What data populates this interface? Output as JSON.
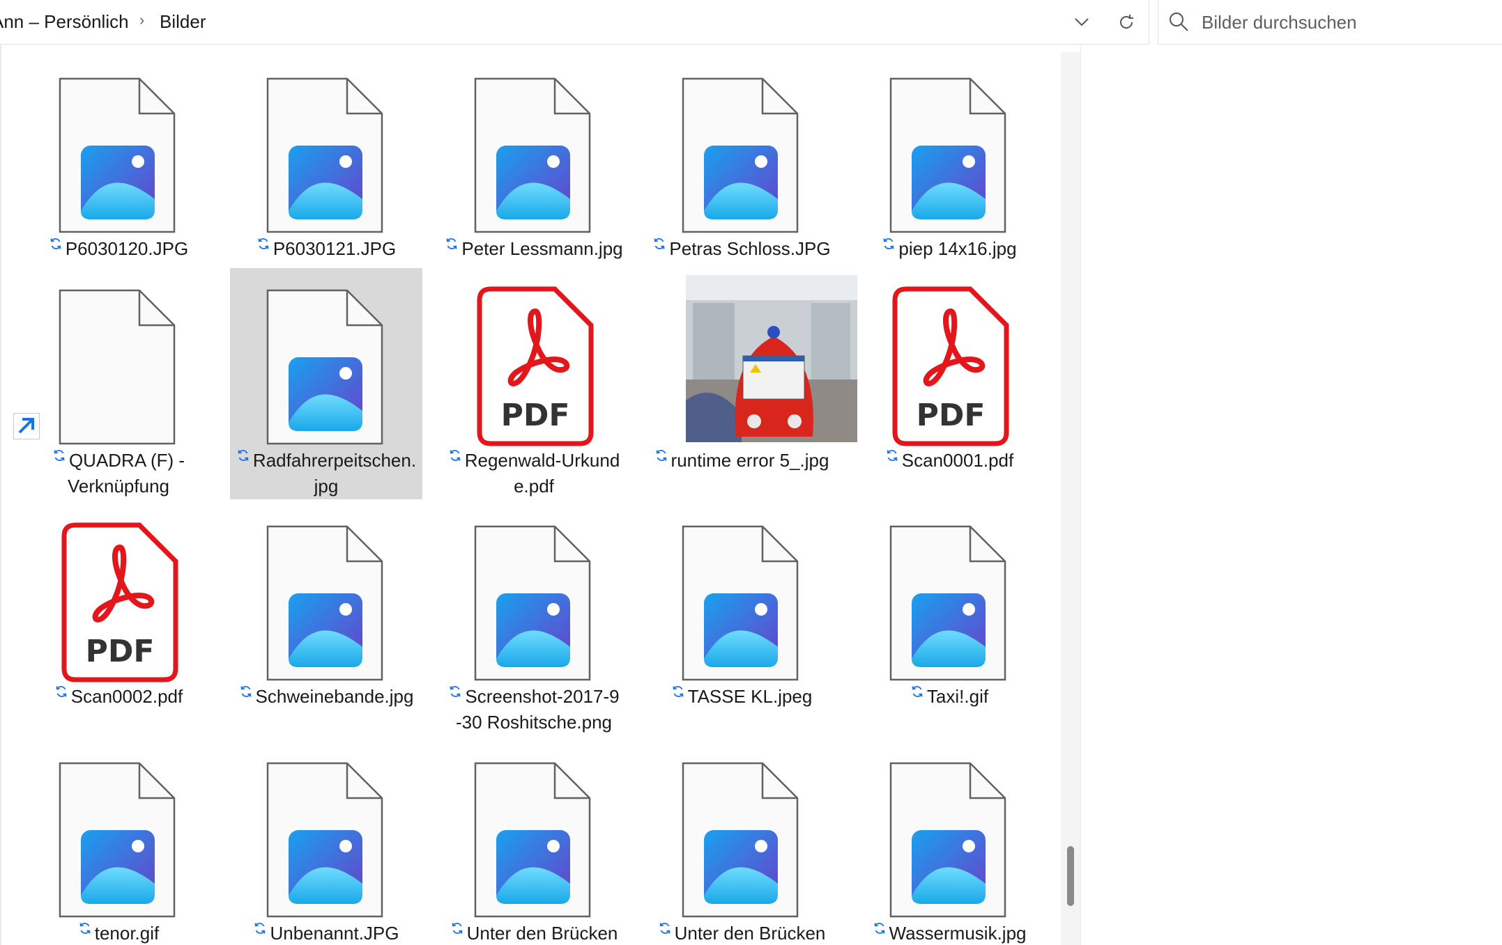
{
  "breadcrumb": {
    "parent": "Ann – Persönlich",
    "current": "Bilder"
  },
  "search": {
    "placeholder": "Bilder durchsuchen"
  },
  "icons": {
    "chevron": "chevron-down-icon",
    "refresh": "refresh-icon",
    "search": "search-icon",
    "sync": "sync-status-icon",
    "image": "image-file-icon",
    "pdf": "pdf-file-icon",
    "blank": "blank-file-icon",
    "shortcut": "shortcut-arrow-icon"
  },
  "colors": {
    "pdf_red": "#e3161b",
    "sync_blue": "#1a73e8",
    "selected_bg": "#d9d9d9"
  },
  "files": [
    {
      "name": "P6030120.JPG",
      "line1": "P6030120.JPG",
      "line2": "",
      "type": "image"
    },
    {
      "name": "P6030121.JPG",
      "line1": "P6030121.JPG",
      "line2": "",
      "type": "image"
    },
    {
      "name": "Peter Lessmann.jpg",
      "line1": "Peter Lessmann.jpg",
      "line2": "",
      "type": "image"
    },
    {
      "name": "Petras Schloss.JPG",
      "line1": "Petras Schloss.JPG",
      "line2": "",
      "type": "image"
    },
    {
      "name": "piep 14x16.jpg",
      "line1": "piep 14x16.jpg",
      "line2": "",
      "type": "image"
    },
    {
      "name": "QUADRA (F) - Verknüpfung",
      "line1": "QUADRA (F) -",
      "line2": "Verknüpfung",
      "type": "shortcut"
    },
    {
      "name": "Radfahrerpeitschen.jpg",
      "line1": "Radfahrerpeitschen.",
      "line2": "jpg",
      "type": "image"
    },
    {
      "name": "Regenwald-Urkunde.pdf",
      "line1": "Regenwald-Urkund",
      "line2": "e.pdf",
      "type": "pdf"
    },
    {
      "name": "runtime error 5_.jpg",
      "line1": "runtime error 5_.jpg",
      "line2": "",
      "type": "photo"
    },
    {
      "name": "Scan0001.pdf",
      "line1": "Scan0001.pdf",
      "line2": "",
      "type": "pdf"
    },
    {
      "name": "Scan0002.pdf",
      "line1": "Scan0002.pdf",
      "line2": "",
      "type": "pdf"
    },
    {
      "name": "Schweinebande.jpg",
      "line1": "Schweinebande.jpg",
      "line2": "",
      "type": "image"
    },
    {
      "name": "Screenshot-2017-9-30 Roshitsche.png",
      "line1": "Screenshot-2017-9",
      "line2": "-30 Roshitsche.png",
      "type": "image"
    },
    {
      "name": "TASSE KL.jpeg",
      "line1": "TASSE KL.jpeg",
      "line2": "",
      "type": "image"
    },
    {
      "name": "Taxi!.gif",
      "line1": "Taxi!.gif",
      "line2": "",
      "type": "image"
    },
    {
      "name": "tenor.gif",
      "line1": "tenor.gif",
      "line2": "",
      "type": "image"
    },
    {
      "name": "Unbenannt.JPG",
      "line1": "Unbenannt.JPG",
      "line2": "",
      "type": "image"
    },
    {
      "name": "Unter den Brücken",
      "line1": "Unter den Brücken",
      "line2": "",
      "type": "image"
    },
    {
      "name": "Unter den Brücken",
      "line1": "Unter den Brücken",
      "line2": "",
      "type": "image"
    },
    {
      "name": "Wassermusik.jpg",
      "line1": "Wassermusik.jpg",
      "line2": "",
      "type": "image"
    }
  ],
  "pdf_badge_text": "PDF",
  "selected_index": 6
}
